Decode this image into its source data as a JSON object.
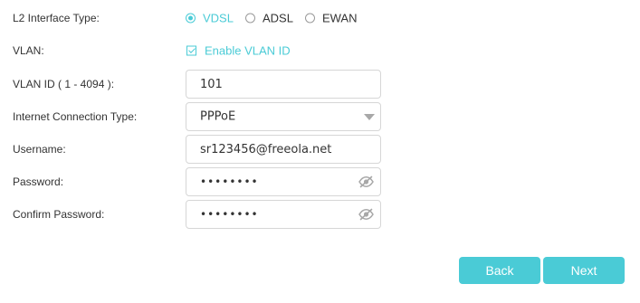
{
  "form": {
    "l2_interface": {
      "label": "L2 Interface Type:",
      "options": [
        "VDSL",
        "ADSL",
        "EWAN"
      ],
      "selected": "VDSL"
    },
    "vlan": {
      "label": "VLAN:",
      "checkbox_label": "Enable VLAN ID",
      "checked": true
    },
    "vlan_id": {
      "label": "VLAN ID ( 1 - 4094 ):",
      "value": "101"
    },
    "connection_type": {
      "label": "Internet Connection Type:",
      "value": "PPPoE"
    },
    "username": {
      "label": "Username:",
      "value": "sr123456@freeola.net"
    },
    "password": {
      "label": "Password:",
      "masked": "••••••••"
    },
    "confirm_password": {
      "label": "Confirm Password:",
      "masked": "••••••••"
    }
  },
  "buttons": {
    "back": "Back",
    "next": "Next"
  },
  "icons": {
    "password_toggle": "eye-slash-icon",
    "dropdown": "caret-down-icon"
  },
  "colors": {
    "accent": "#4acbd6",
    "text": "#333333",
    "border": "#d6d6d6",
    "icon_gray": "#a8a8a8"
  }
}
